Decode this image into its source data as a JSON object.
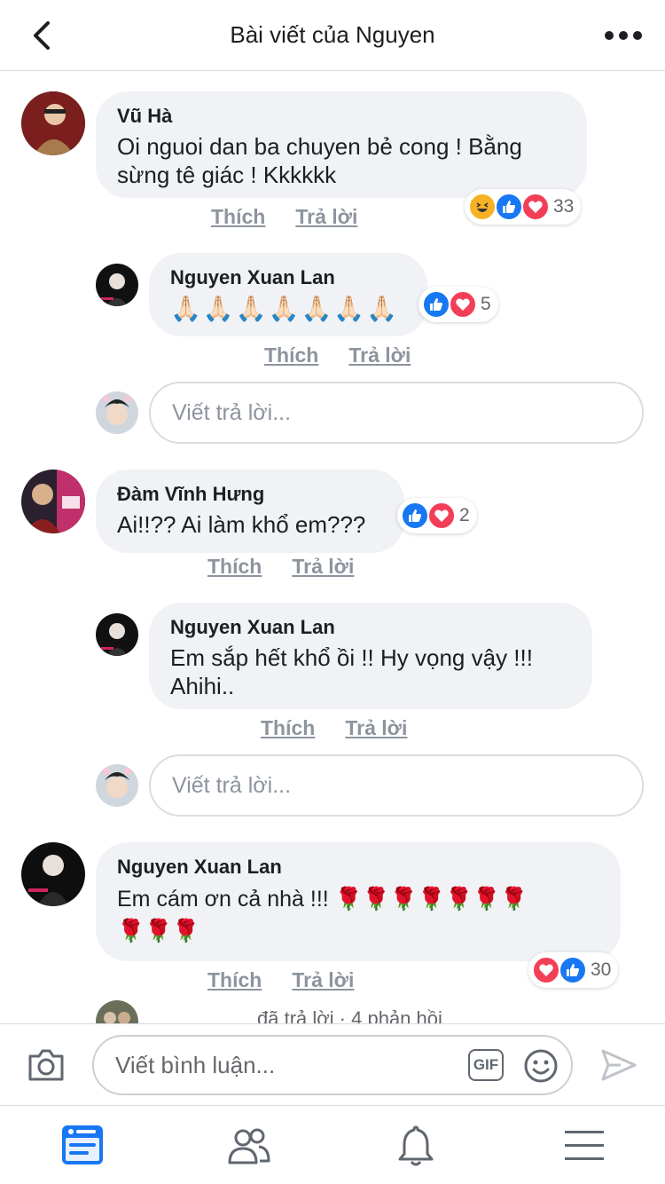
{
  "header": {
    "title": "Bài viết của Nguyen"
  },
  "comments": [
    {
      "name": "Vũ Hà",
      "text_line1": "Oi nguoi dan ba chuyen bẻ cong ! Bằng",
      "text_line2": "sừng tê giác ! Kkkkkk",
      "reactions": [
        "haha-icon",
        "like-icon",
        "love-icon"
      ],
      "reaction_count": "33"
    },
    {
      "name": "Nguyen Xuan Lan",
      "emoji_text": "🙏🏻🙏🏻🙏🏻🙏🏻🙏🏻🙏🏻🙏🏻",
      "reactions": [
        "like-icon",
        "love-icon"
      ],
      "reaction_count": "5"
    },
    {
      "name": "Đàm Vĩnh Hưng",
      "text_line1": "Ai!!?? Ai làm khổ em???",
      "reactions": [
        "like-icon",
        "love-icon"
      ],
      "reaction_count": "2"
    },
    {
      "name": "Nguyen Xuan Lan",
      "text_line1": "Em sắp hết khổ ồi !! Hy vọng vậy !!!",
      "text_line2": "Ahihi.."
    },
    {
      "name": "Nguyen Xuan Lan",
      "text_line1": "Em cám ơn cả nhà !!! 🌹🌹🌹🌹🌹🌹🌹",
      "text_line2": "🌹🌹🌹",
      "reactions": [
        "love-icon",
        "like-icon"
      ],
      "reaction_count": "30"
    }
  ],
  "actions": {
    "like": "Thích",
    "reply": "Trả lời"
  },
  "reply_placeholder": "Viết trả lời...",
  "replies_summary": "đã trả lời · 4 phản hồi",
  "comment_bar": {
    "placeholder": "Viết bình luận...",
    "gif_label": "GIF"
  },
  "tabs": [
    "news-feed-icon",
    "friends-icon",
    "notifications-icon",
    "menu-icon"
  ],
  "colors": {
    "accent": "#1877f2",
    "love": "#f33e58",
    "haha": "#f7b125",
    "bubble": "#f0f2f5",
    "muted": "#8d949e"
  }
}
